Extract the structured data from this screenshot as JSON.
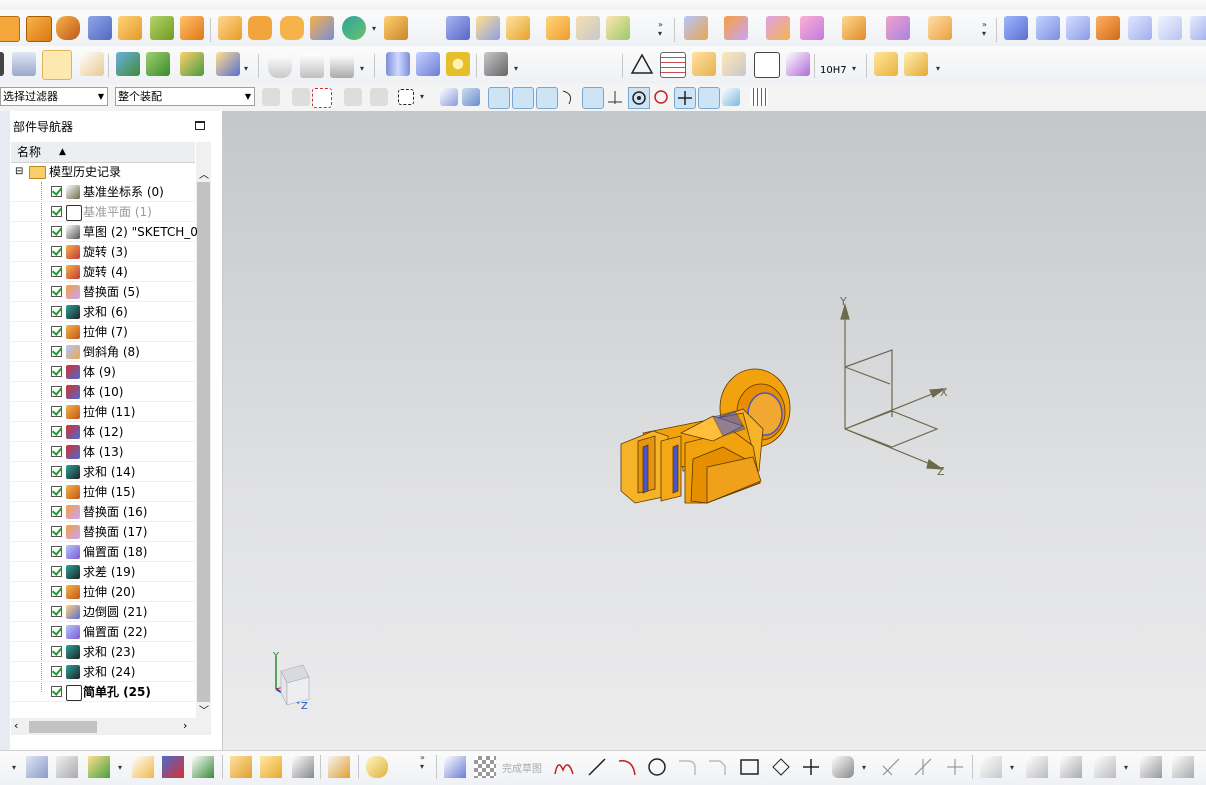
{
  "filters": {
    "selection_filter": "选择过滤器",
    "assembly_scope": "整个装配"
  },
  "navigator": {
    "title": "部件导航器",
    "column_name": "名称",
    "root_label": "模型历史记录",
    "items": [
      {
        "label": "基准坐标系 (0)",
        "icon": "datum-csys-icon",
        "dim": false,
        "bold": false
      },
      {
        "label": "基准平面 (1)",
        "icon": "datum-plane-icon",
        "dim": true,
        "bold": false
      },
      {
        "label": "草图 (2) \"SKETCH_0",
        "icon": "sketch-icon",
        "dim": false,
        "bold": false
      },
      {
        "label": "旋转 (3)",
        "icon": "revolve-icon",
        "dim": false,
        "bold": false
      },
      {
        "label": "旋转 (4)",
        "icon": "revolve-icon",
        "dim": false,
        "bold": false
      },
      {
        "label": "替换面 (5)",
        "icon": "replace-face-icon",
        "dim": false,
        "bold": false
      },
      {
        "label": "求和 (6)",
        "icon": "unite-icon",
        "dim": false,
        "bold": false
      },
      {
        "label": "拉伸 (7)",
        "icon": "extrude-icon",
        "dim": false,
        "bold": false
      },
      {
        "label": "倒斜角 (8)",
        "icon": "chamfer-icon",
        "dim": false,
        "bold": false
      },
      {
        "label": "体 (9)",
        "icon": "body-icon",
        "dim": false,
        "bold": false
      },
      {
        "label": "体 (10)",
        "icon": "body-icon",
        "dim": false,
        "bold": false
      },
      {
        "label": "拉伸 (11)",
        "icon": "extrude-icon",
        "dim": false,
        "bold": false
      },
      {
        "label": "体 (12)",
        "icon": "body-icon",
        "dim": false,
        "bold": false
      },
      {
        "label": "体 (13)",
        "icon": "body-icon",
        "dim": false,
        "bold": false
      },
      {
        "label": "求和 (14)",
        "icon": "unite-icon",
        "dim": false,
        "bold": false
      },
      {
        "label": "拉伸 (15)",
        "icon": "extrude-icon",
        "dim": false,
        "bold": false
      },
      {
        "label": "替换面 (16)",
        "icon": "replace-face-icon",
        "dim": false,
        "bold": false
      },
      {
        "label": "替换面 (17)",
        "icon": "replace-face-icon",
        "dim": false,
        "bold": false
      },
      {
        "label": "偏置面 (18)",
        "icon": "offset-face-icon",
        "dim": false,
        "bold": false
      },
      {
        "label": "求差 (19)",
        "icon": "subtract-icon",
        "dim": false,
        "bold": false
      },
      {
        "label": "拉伸 (20)",
        "icon": "extrude-icon",
        "dim": false,
        "bold": false
      },
      {
        "label": "边倒圆 (21)",
        "icon": "edge-blend-icon",
        "dim": false,
        "bold": false
      },
      {
        "label": "偏置面 (22)",
        "icon": "offset-face-icon",
        "dim": false,
        "bold": false
      },
      {
        "label": "求和 (23)",
        "icon": "unite-icon",
        "dim": false,
        "bold": false
      },
      {
        "label": "求和 (24)",
        "icon": "unite-icon",
        "dim": false,
        "bold": false
      },
      {
        "label": "简单孔 (25)",
        "icon": "simple-hole-icon",
        "dim": false,
        "bold": true
      }
    ]
  },
  "toolbar": {
    "tolerance_label": "10H7",
    "finish_sketch_label": "完成草图"
  },
  "viewport": {
    "datum_axes": {
      "x": "X",
      "y": "Y",
      "z": "Z"
    },
    "triad_axes": {
      "y": "Y",
      "z": "Z"
    },
    "part_color": "#f2a20c",
    "accent_color": "#4a55c8"
  },
  "colors": {
    "check_green": "#1e9a2a",
    "datum_line": "#6b6a4a"
  }
}
